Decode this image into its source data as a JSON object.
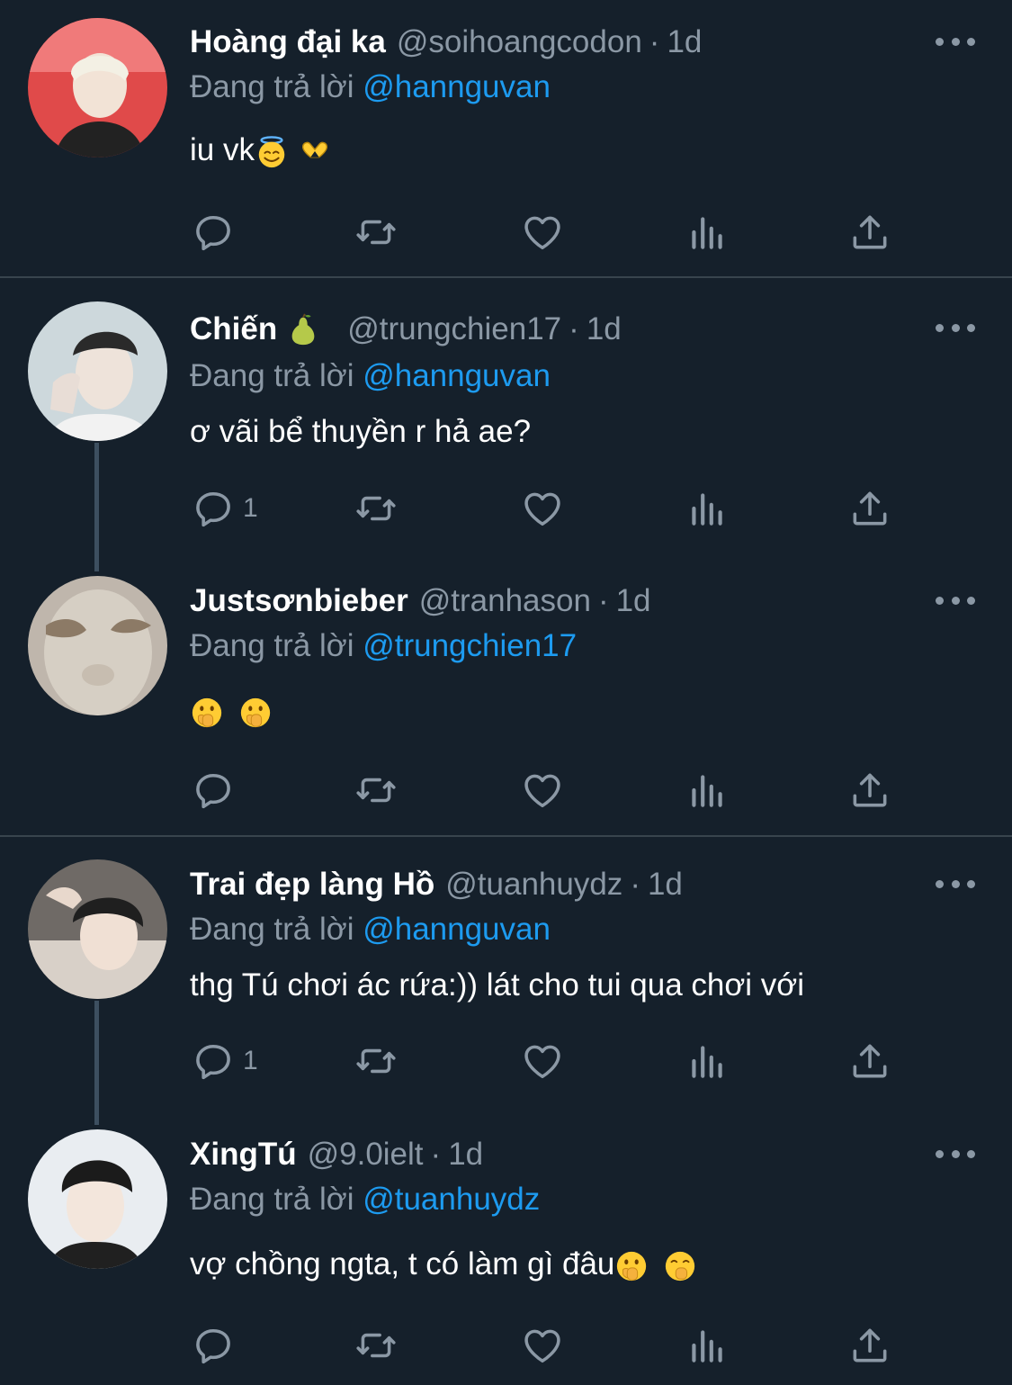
{
  "reply_prefix": "Đang trả lời",
  "colors": {
    "background": "#15202b",
    "accent": "#1d9bf0",
    "muted": "#8b98a5",
    "divider": "#38444d"
  },
  "tweets": [
    {
      "name": "Hoàng đại ka",
      "handle": "@soihoangcodon",
      "time": "1d",
      "reply_to": "@hannguvan",
      "text": "iu vk",
      "emojis": [
        "smiling-face-with-halo",
        "heart-hands"
      ],
      "reply_count": ""
    },
    {
      "name": "Chiến",
      "name_emoji": "pear",
      "handle": "@trungchien17",
      "time": "1d",
      "reply_to": "@hannguvan",
      "text": "ơ vãi bể thuyền r hả ae?",
      "reply_count": "1"
    },
    {
      "name": "Justsơnbieber",
      "handle": "@tranhason",
      "time": "1d",
      "reply_to": "@trungchien17",
      "text": "",
      "emojis": [
        "face-with-open-eyes-and-hand-over-mouth",
        "face-with-open-eyes-and-hand-over-mouth"
      ],
      "reply_count": ""
    },
    {
      "name": "Trai đẹp làng Hồ",
      "handle": "@tuanhuydz",
      "time": "1d",
      "reply_to": "@hannguvan",
      "text": "thg Tú chơi ác rứa:)) lát cho tui qua chơi với",
      "reply_count": "1"
    },
    {
      "name": "XingTú",
      "handle": "@9.0ielt",
      "time": "1d",
      "reply_to": "@tuanhuydz",
      "text": "vợ chồng ngta, t có làm gì đâu",
      "emojis": [
        "face-with-open-eyes-and-hand-over-mouth",
        "face-with-hand-over-mouth"
      ],
      "reply_count": ""
    }
  ]
}
